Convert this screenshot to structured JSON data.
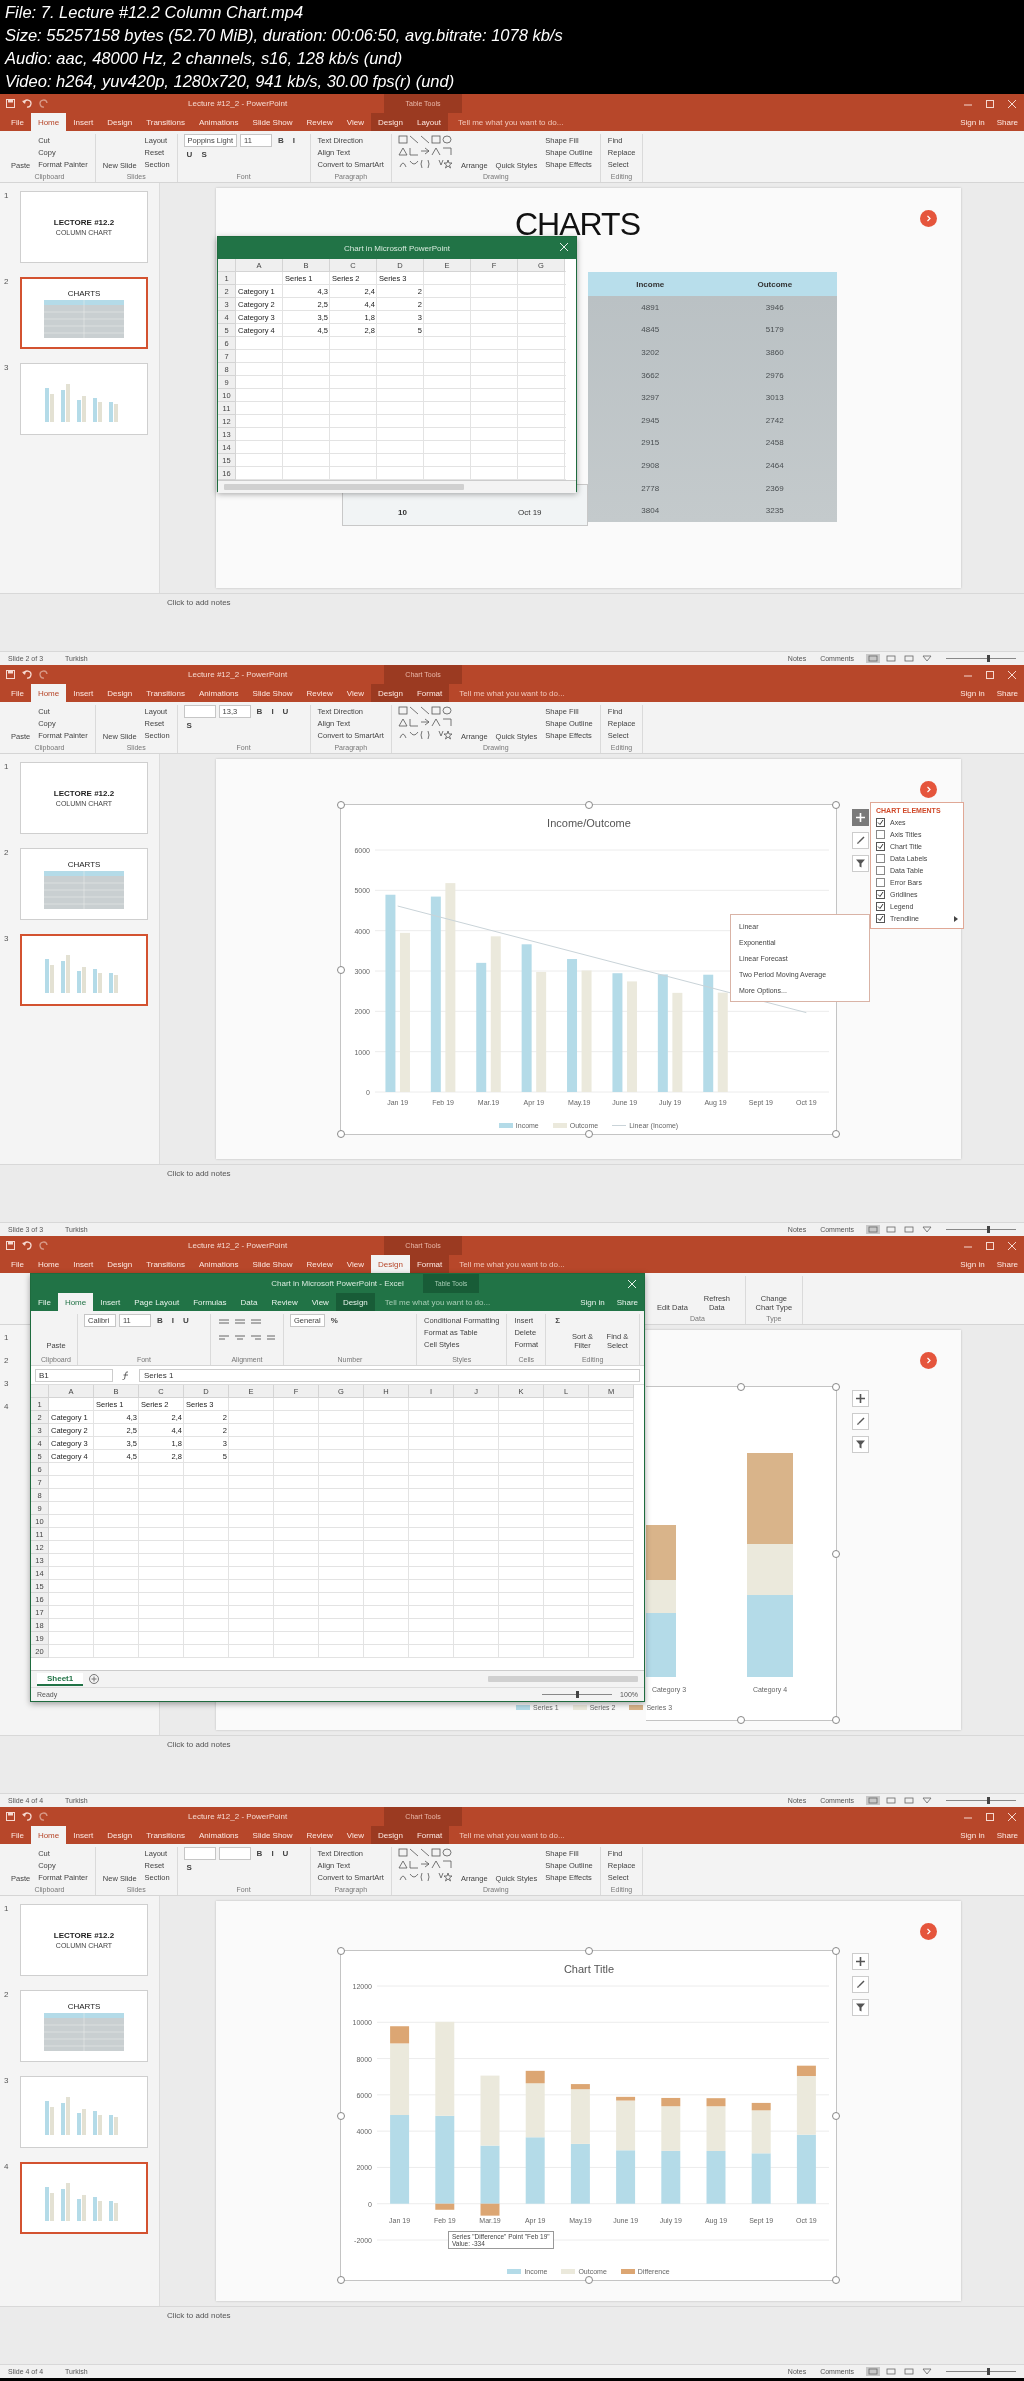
{
  "header": [
    "File: 7. Lecture #12.2 Column Chart.mp4",
    "Size: 55257158 bytes (52.70 MiB), duration: 00:06:50, avg.bitrate: 1078 kb/s",
    "Audio: aac, 48000 Hz, 2 channels, s16, 128 kb/s (und)",
    "Video: h264, yuv420p, 1280x720, 941 kb/s, 30.00 fps(r) (und)"
  ],
  "frames": [
    {
      "kind": "table",
      "title": "Lecture #12_2 - PowerPoint",
      "context_label": "Table Tools",
      "tabs": [
        {
          "label": "File",
          "selected": false,
          "contextual": false
        },
        {
          "label": "Home",
          "selected": true,
          "contextual": false
        },
        {
          "label": "Insert",
          "selected": false,
          "contextual": false
        },
        {
          "label": "Design",
          "selected": false,
          "contextual": false
        },
        {
          "label": "Transitions",
          "selected": false,
          "contextual": false
        },
        {
          "label": "Animations",
          "selected": false,
          "contextual": false
        },
        {
          "label": "Slide Show",
          "selected": false,
          "contextual": false
        },
        {
          "label": "Review",
          "selected": false,
          "contextual": false
        },
        {
          "label": "View",
          "selected": false,
          "contextual": false
        },
        {
          "label": "Design",
          "selected": false,
          "contextual": true
        },
        {
          "label": "Layout",
          "selected": false,
          "contextual": true
        }
      ],
      "tell_me": "Tell me what you want to do...",
      "sign_in": "Sign in",
      "share": "Share",
      "ribbon": [
        {
          "label": "Clipboard",
          "kind": "stack",
          "items": [
            {
              "kind": "big",
              "text": "Paste"
            },
            {
              "kind": "button",
              "text": "Cut"
            },
            {
              "kind": "button",
              "text": "Copy"
            },
            {
              "kind": "button",
              "text": "Format Painter"
            }
          ]
        },
        {
          "label": "Slides",
          "kind": "stack",
          "items": [
            {
              "kind": "big",
              "text": "New Slide"
            },
            {
              "kind": "button",
              "text": "Layout"
            },
            {
              "kind": "button",
              "text": "Reset"
            },
            {
              "kind": "button",
              "text": "Section"
            }
          ]
        },
        {
          "label": "Font",
          "kind": "wrap",
          "items": [
            {
              "kind": "field",
              "text": "Poppins Light"
            },
            {
              "kind": "field",
              "text": "11"
            },
            {
              "kind": "format",
              "text": "B"
            },
            {
              "kind": "format",
              "text": "I"
            },
            {
              "kind": "format",
              "text": "U"
            },
            {
              "kind": "format",
              "text": "S"
            }
          ]
        },
        {
          "label": "Paragraph",
          "kind": "stack",
          "items": [
            {
              "kind": "button",
              "text": "Text Direction"
            },
            {
              "kind": "button",
              "text": "Align Text"
            },
            {
              "kind": "button",
              "text": "Convert to SmartArt"
            }
          ]
        },
        {
          "label": "Drawing",
          "kind": "stack",
          "items": [
            {
              "kind": "shapes"
            },
            {
              "kind": "big",
              "text": "Arrange"
            },
            {
              "kind": "big",
              "text": "Quick Styles"
            },
            {
              "kind": "button",
              "text": "Shape Fill"
            },
            {
              "kind": "button",
              "text": "Shape Outline"
            },
            {
              "kind": "button",
              "text": "Shape Effects"
            }
          ]
        },
        {
          "label": "Editing",
          "kind": "stack",
          "items": [
            {
              "kind": "button",
              "text": "Find"
            },
            {
              "kind": "button",
              "text": "Replace"
            },
            {
              "kind": "button",
              "text": "Select"
            }
          ]
        }
      ],
      "thumbnails": [
        {
          "number": "1",
          "kind": "title",
          "title": "LECTORE #12.2",
          "subtitle": "COLUMN CHART",
          "selected": false
        },
        {
          "number": "2",
          "kind": "table",
          "title": "CHARTS",
          "selected": true
        },
        {
          "number": "3",
          "kind": "chart",
          "selected": false
        }
      ],
      "slide": {
        "title": "CHARTS",
        "table": {
          "columns": [
            "Income",
            "Outcome"
          ],
          "rows": [
            [
              "4891",
              "3946"
            ],
            [
              "4845",
              "5179"
            ],
            [
              "3202",
              "3860"
            ],
            [
              "3662",
              "2976"
            ],
            [
              "3297",
              "3013"
            ],
            [
              "2945",
              "2742"
            ],
            [
              "2915",
              "2458"
            ],
            [
              "2908",
              "2464"
            ],
            [
              "2778",
              "2369"
            ],
            [
              "3804",
              "3235"
            ]
          ]
        },
        "strip": [
          "10",
          "Oct 19"
        ],
        "excel": {
          "kind": "mini",
          "title": "Chart in Microsoft PowerPoint",
          "columns": [
            "A",
            "B",
            "C",
            "D",
            "E",
            "F",
            "G"
          ],
          "row_numbers": [
            "1",
            "2",
            "3",
            "4",
            "5",
            "6",
            "7",
            "8",
            "9",
            "10",
            "11",
            "12",
            "13",
            "14",
            "15",
            "16"
          ],
          "sheet": {
            "headers": [
              "Series 1",
              "Series 2",
              "Series 3"
            ],
            "rows": [
              {
                "label": "Category 1",
                "values": [
                  "4,3",
                  "2,4",
                  "2"
                ]
              },
              {
                "label": "Category 2",
                "values": [
                  "2,5",
                  "4,4",
                  "2"
                ]
              },
              {
                "label": "Category 3",
                "values": [
                  "3,5",
                  "1,8",
                  "3"
                ]
              },
              {
                "label": "Category 4",
                "values": [
                  "4,5",
                  "2,8",
                  "5"
                ]
              }
            ]
          }
        }
      },
      "notes_placeholder": "Click to add notes",
      "status": {
        "slide": "Slide 2 of 3",
        "language": "Turkish",
        "notes": "Notes",
        "comments": "Comments",
        "zoom": {
          "level": 0.6
        }
      }
    },
    {
      "kind": "chart",
      "title": "Lecture #12_2 - PowerPoint",
      "context_label": "Chart Tools",
      "tabs": [
        {
          "label": "File",
          "selected": false,
          "contextual": false
        },
        {
          "label": "Home",
          "selected": true,
          "contextual": false
        },
        {
          "label": "Insert",
          "selected": false,
          "contextual": false
        },
        {
          "label": "Design",
          "selected": false,
          "contextual": false
        },
        {
          "label": "Transitions",
          "selected": false,
          "contextual": false
        },
        {
          "label": "Animations",
          "selected": false,
          "contextual": false
        },
        {
          "label": "Slide Show",
          "selected": false,
          "contextual": false
        },
        {
          "label": "Review",
          "selected": false,
          "contextual": false
        },
        {
          "label": "View",
          "selected": false,
          "contextual": false
        },
        {
          "label": "Design",
          "selected": false,
          "contextual": true
        },
        {
          "label": "Format",
          "selected": false,
          "contextual": true
        }
      ],
      "tell_me": "Tell me what you want to do...",
      "sign_in": "Sign in",
      "share": "Share",
      "ribbon": [
        {
          "label": "Clipboard",
          "kind": "stack",
          "items": [
            {
              "kind": "big",
              "text": "Paste"
            },
            {
              "kind": "button",
              "text": "Cut"
            },
            {
              "kind": "button",
              "text": "Copy"
            },
            {
              "kind": "button",
              "text": "Format Painter"
            }
          ]
        },
        {
          "label": "Slides",
          "kind": "stack",
          "items": [
            {
              "kind": "big",
              "text": "New Slide"
            },
            {
              "kind": "button",
              "text": "Layout"
            },
            {
              "kind": "button",
              "text": "Reset"
            },
            {
              "kind": "button",
              "text": "Section"
            }
          ]
        },
        {
          "label": "Font",
          "kind": "wrap",
          "items": [
            {
              "kind": "field"
            },
            {
              "kind": "field",
              "text": "13,3"
            },
            {
              "kind": "format",
              "text": "B"
            },
            {
              "kind": "format",
              "text": "I"
            },
            {
              "kind": "format",
              "text": "U"
            },
            {
              "kind": "format",
              "text": "S"
            }
          ]
        },
        {
          "label": "Paragraph",
          "kind": "stack",
          "items": [
            {
              "kind": "button",
              "text": "Text Direction"
            },
            {
              "kind": "button",
              "text": "Align Text"
            },
            {
              "kind": "button",
              "text": "Convert to SmartArt"
            }
          ]
        },
        {
          "label": "Drawing",
          "kind": "stack",
          "items": [
            {
              "kind": "shapes"
            },
            {
              "kind": "big",
              "text": "Arrange"
            },
            {
              "kind": "big",
              "text": "Quick Styles"
            },
            {
              "kind": "button",
              "text": "Shape Fill"
            },
            {
              "kind": "button",
              "text": "Shape Outline"
            },
            {
              "kind": "button",
              "text": "Shape Effects"
            }
          ]
        },
        {
          "label": "Editing",
          "kind": "stack",
          "items": [
            {
              "kind": "button",
              "text": "Find"
            },
            {
              "kind": "button",
              "text": "Replace"
            },
            {
              "kind": "button",
              "text": "Select"
            }
          ]
        }
      ],
      "thumbnails": [
        {
          "number": "1",
          "kind": "title",
          "title": "LECTORE #12.2",
          "subtitle": "COLUMN CHART",
          "selected": false
        },
        {
          "number": "2",
          "kind": "table",
          "title": "CHARTS",
          "selected": false
        },
        {
          "number": "3",
          "kind": "chart",
          "selected": true
        }
      ],
      "slide": {
        "chart_data": {
          "type": "bar",
          "title": "Income/Outcome",
          "categories": [
            "Jan 19",
            "Feb 19",
            "Mar.19",
            "Apr 19",
            "May.19",
            "June 19",
            "July 19",
            "Aug 19",
            "Sept 19",
            "Oct 19"
          ],
          "series": [
            {
              "name": "Income",
              "color": "#b4dbe8",
              "values": [
                4891,
                4845,
                3202,
                3662,
                3297,
                2945,
                2915,
                2908,
                null,
                null
              ]
            },
            {
              "name": "Outcome",
              "color": "#ebe9dc",
              "values": [
                3946,
                5179,
                3860,
                2976,
                3013,
                2742,
                2458,
                2464,
                null,
                null
              ]
            }
          ],
          "yticks": [
            0,
            1000,
            2000,
            3000,
            4000,
            5000,
            6000
          ],
          "ylim": [
            0,
            6000
          ],
          "grid": true,
          "stacked": false
        },
        "trendline": {
          "label": "Linear (Income)"
        },
        "chart_elements": {
          "title": "CHART ELEMENTS",
          "items": [
            {
              "label": "Axes",
              "checked": true,
              "submenu": false
            },
            {
              "label": "Axis Titles",
              "checked": false,
              "submenu": false
            },
            {
              "label": "Chart Title",
              "checked": true,
              "submenu": false
            },
            {
              "label": "Data Labels",
              "checked": false,
              "submenu": false
            },
            {
              "label": "Data Table",
              "checked": false,
              "submenu": false
            },
            {
              "label": "Error Bars",
              "checked": false,
              "submenu": false
            },
            {
              "label": "Gridlines",
              "checked": true,
              "submenu": false
            },
            {
              "label": "Legend",
              "checked": true,
              "submenu": false
            },
            {
              "label": "Trendline",
              "checked": true,
              "submenu": true
            }
          ]
        },
        "submenu": [
          "Linear",
          "Exponential",
          "Linear Forecast",
          "Two Period Moving Average",
          "More Options..."
        ]
      },
      "notes_placeholder": "Click to add notes",
      "status": {
        "slide": "Slide 3 of 3",
        "language": "Turkish",
        "notes": "Notes",
        "comments": "Comments",
        "zoom": {
          "level": 0.6
        }
      }
    },
    {
      "kind": "excel_over_chart",
      "title": "Lecture #12_2 - PowerPoint",
      "context_label": "Chart Tools",
      "tabs": [
        {
          "label": "File",
          "selected": false,
          "contextual": false
        },
        {
          "label": "Home",
          "selected": false,
          "contextual": false
        },
        {
          "label": "Insert",
          "selected": false,
          "contextual": false
        },
        {
          "label": "Design",
          "selected": false,
          "contextual": false
        },
        {
          "label": "Transitions",
          "selected": false,
          "contextual": false
        },
        {
          "label": "Animations",
          "selected": false,
          "contextual": false
        },
        {
          "label": "Slide Show",
          "selected": false,
          "contextual": false
        },
        {
          "label": "Review",
          "selected": false,
          "contextual": false
        },
        {
          "label": "View",
          "selected": false,
          "contextual": false
        },
        {
          "label": "Design",
          "selected": true,
          "contextual": true
        },
        {
          "label": "Format",
          "selected": false,
          "contextual": true
        }
      ],
      "tell_me": "Tell me what you want to do...",
      "sign_in": "Sign in",
      "share": "Share",
      "ribbon": [
        {
          "label": "Data",
          "kind": "stack",
          "items": [
            {
              "kind": "big",
              "text": "Edit Data"
            },
            {
              "kind": "big",
              "text": "Refresh Data"
            }
          ]
        },
        {
          "label": "Type",
          "kind": "stack",
          "items": [
            {
              "kind": "big",
              "text": "Change Chart Type"
            }
          ]
        }
      ],
      "thumbnails": [
        {
          "number": "1",
          "kind": "covered"
        },
        {
          "number": "2",
          "kind": "covered"
        },
        {
          "number": "3",
          "kind": "covered"
        },
        {
          "number": "4",
          "kind": "covered"
        }
      ],
      "slide": {
        "categories": [
          "Category 3",
          "Category 4"
        ],
        "legend": [
          {
            "label": "Series 1",
            "color": "#b4dbe8"
          },
          {
            "label": "Series 2",
            "color": "#ebe9dc"
          },
          {
            "label": "Series 3",
            "color": "#d9b48a"
          }
        ],
        "excel": {
          "kind": "full",
          "title": "Chart in Microsoft PowerPoint - Excel",
          "context_label": "Table Tools",
          "tabs": [
            {
              "label": "File",
              "selected": false,
              "contextual": false
            },
            {
              "label": "Home",
              "selected": true,
              "contextual": false
            },
            {
              "label": "Insert",
              "selected": false,
              "contextual": false
            },
            {
              "label": "Page Layout",
              "selected": false,
              "contextual": false
            },
            {
              "label": "Formulas",
              "selected": false,
              "contextual": false
            },
            {
              "label": "Data",
              "selected": false,
              "contextual": false
            },
            {
              "label": "Review",
              "selected": false,
              "contextual": false
            },
            {
              "label": "View",
              "selected": false,
              "contextual": false
            },
            {
              "label": "Design",
              "selected": false,
              "contextual": true
            }
          ],
          "tell_me": "Tell me what you want to do...",
          "sign_in": "Sign in",
          "share": "Share",
          "ribbon": [
            {
              "label": "Clipboard",
              "kind": "stack",
              "items": [
                {
                  "kind": "big",
                  "text": "Paste"
                }
              ]
            },
            {
              "label": "Font",
              "kind": "wrap",
              "items": [
                {
                  "kind": "field",
                  "text": "Calibri"
                },
                {
                  "kind": "field",
                  "text": "11"
                },
                {
                  "kind": "format",
                  "text": "B"
                },
                {
                  "kind": "format",
                  "text": "I"
                },
                {
                  "kind": "format",
                  "text": "U"
                }
              ]
            },
            {
              "label": "Alignment",
              "kind": "stack",
              "items": [
                {
                  "kind": "align"
                }
              ]
            },
            {
              "label": "Number",
              "kind": "wrap",
              "items": [
                {
                  "kind": "field",
                  "text": "General"
                },
                {
                  "kind": "format",
                  "text": "%"
                }
              ]
            },
            {
              "label": "Styles",
              "kind": "stack",
              "items": [
                {
                  "kind": "button",
                  "text": "Conditional Formatting"
                },
                {
                  "kind": "button",
                  "text": "Format as Table"
                },
                {
                  "kind": "button",
                  "text": "Cell Styles"
                }
              ]
            },
            {
              "label": "Cells",
              "kind": "stack",
              "items": [
                {
                  "kind": "button",
                  "text": "Insert"
                },
                {
                  "kind": "button",
                  "text": "Delete"
                },
                {
                  "kind": "button",
                  "text": "Format"
                }
              ]
            },
            {
              "label": "Editing",
              "kind": "stack",
              "items": [
                {
                  "kind": "format",
                  "text": "Σ"
                },
                {
                  "kind": "big",
                  "text": "Sort & Filter"
                },
                {
                  "kind": "big",
                  "text": "Find & Select"
                }
              ]
            }
          ],
          "name_box": "B1",
          "formula": "Series 1",
          "columns": [
            "A",
            "B",
            "C",
            "D",
            "E",
            "F",
            "G",
            "H",
            "I",
            "J",
            "K",
            "L",
            "M"
          ],
          "row_numbers": [
            "1",
            "2",
            "3",
            "4",
            "5",
            "6",
            "7",
            "8",
            "9",
            "10",
            "11",
            "12",
            "13",
            "14",
            "15",
            "16",
            "17",
            "18",
            "19",
            "20"
          ],
          "sheet": {
            "headers": [
              "Series 1",
              "Series 2",
              "Series 3"
            ],
            "rows": [
              {
                "label": "Category 1",
                "values": [
                  "4,3",
                  "2,4",
                  "2"
                ]
              },
              {
                "label": "Category 2",
                "values": [
                  "2,5",
                  "4,4",
                  "2"
                ]
              },
              {
                "label": "Category 3",
                "values": [
                  "3,5",
                  "1,8",
                  "3"
                ]
              },
              {
                "label": "Category 4",
                "values": [
                  "4,5",
                  "2,8",
                  "5"
                ]
              }
            ]
          },
          "sheet_tab": "Sheet1",
          "status": "Ready",
          "zoom": {
            "label": "100%",
            "level": 0.5
          }
        }
      },
      "notes_placeholder": "Click to add notes",
      "status": {
        "slide": "Slide 4 of 4",
        "language": "Turkish",
        "notes": "Notes",
        "comments": "Comments",
        "zoom": {
          "level": 0.6
        }
      }
    },
    {
      "kind": "stacked_chart",
      "title": "Lecture #12_2 - PowerPoint",
      "context_label": "Chart Tools",
      "tabs": [
        {
          "label": "File",
          "selected": false,
          "contextual": false
        },
        {
          "label": "Home",
          "selected": true,
          "contextual": false
        },
        {
          "label": "Insert",
          "selected": false,
          "contextual": false
        },
        {
          "label": "Design",
          "selected": false,
          "contextual": false
        },
        {
          "label": "Transitions",
          "selected": false,
          "contextual": false
        },
        {
          "label": "Animations",
          "selected": false,
          "contextual": false
        },
        {
          "label": "Slide Show",
          "selected": false,
          "contextual": false
        },
        {
          "label": "Review",
          "selected": false,
          "contextual": false
        },
        {
          "label": "View",
          "selected": false,
          "contextual": false
        },
        {
          "label": "Design",
          "selected": false,
          "contextual": true
        },
        {
          "label": "Format",
          "selected": false,
          "contextual": true
        }
      ],
      "tell_me": "Tell me what you want to do...",
      "sign_in": "Sign in",
      "share": "Share",
      "ribbon": [
        {
          "label": "Clipboard",
          "kind": "stack",
          "items": [
            {
              "kind": "big",
              "text": "Paste"
            },
            {
              "kind": "button",
              "text": "Cut"
            },
            {
              "kind": "button",
              "text": "Copy"
            },
            {
              "kind": "button",
              "text": "Format Painter"
            }
          ]
        },
        {
          "label": "Slides",
          "kind": "stack",
          "items": [
            {
              "kind": "big",
              "text": "New Slide"
            },
            {
              "kind": "button",
              "text": "Layout"
            },
            {
              "kind": "button",
              "text": "Reset"
            },
            {
              "kind": "button",
              "text": "Section"
            }
          ]
        },
        {
          "label": "Font",
          "kind": "wrap",
          "items": [
            {
              "kind": "field"
            },
            {
              "kind": "field"
            },
            {
              "kind": "format",
              "text": "B"
            },
            {
              "kind": "format",
              "text": "I"
            },
            {
              "kind": "format",
              "text": "U"
            },
            {
              "kind": "format",
              "text": "S"
            }
          ]
        },
        {
          "label": "Paragraph",
          "kind": "stack",
          "items": [
            {
              "kind": "button",
              "text": "Text Direction"
            },
            {
              "kind": "button",
              "text": "Align Text"
            },
            {
              "kind": "button",
              "text": "Convert to SmartArt"
            }
          ]
        },
        {
          "label": "Drawing",
          "kind": "stack",
          "items": [
            {
              "kind": "shapes"
            },
            {
              "kind": "big",
              "text": "Arrange"
            },
            {
              "kind": "big",
              "text": "Quick Styles"
            },
            {
              "kind": "button",
              "text": "Shape Fill"
            },
            {
              "kind": "button",
              "text": "Shape Outline"
            },
            {
              "kind": "button",
              "text": "Shape Effects"
            }
          ]
        },
        {
          "label": "Editing",
          "kind": "stack",
          "items": [
            {
              "kind": "button",
              "text": "Find"
            },
            {
              "kind": "button",
              "text": "Replace"
            },
            {
              "kind": "button",
              "text": "Select"
            }
          ]
        }
      ],
      "thumbnails": [
        {
          "number": "1",
          "kind": "title",
          "title": "LECTORE #12.2",
          "subtitle": "COLUMN CHART",
          "selected": false
        },
        {
          "number": "2",
          "kind": "table",
          "title": "CHARTS",
          "selected": false
        },
        {
          "number": "3",
          "kind": "chart",
          "selected": false
        },
        {
          "number": "4",
          "kind": "chart",
          "selected": true
        }
      ],
      "slide": {
        "chart_data": {
          "type": "bar",
          "title": "Chart Title",
          "categories": [
            "Jan 19",
            "Feb 19",
            "Mar.19",
            "Apr 19",
            "May.19",
            "June 19",
            "July 19",
            "Aug 19",
            "Sept 19",
            "Oct 19"
          ],
          "series": [
            {
              "name": "Income",
              "color": "#b4dbe8",
              "values": [
                4891,
                4845,
                3202,
                3662,
                3297,
                2945,
                2915,
                2908,
                2778,
                3804
              ]
            },
            {
              "name": "Outcome",
              "color": "#ebe9dc",
              "values": [
                3946,
                5179,
                3860,
                2976,
                3013,
                2742,
                2458,
                2464,
                2369,
                3235
              ]
            },
            {
              "name": "Difference",
              "color": "#dca673",
              "values": [
                945,
                -334,
                -658,
                686,
                284,
                203,
                457,
                444,
                409,
                569
              ]
            }
          ],
          "yticks": [
            -2000,
            0,
            2000,
            4000,
            6000,
            8000,
            10000,
            12000
          ],
          "ylim": [
            -2000,
            12000
          ],
          "grid": true,
          "stacked": true
        },
        "tooltip": [
          "Series \"Difference\" Point \"Feb 19\"",
          "Value: -334"
        ]
      },
      "notes_placeholder": "Click to add notes",
      "status": {
        "slide": "Slide 4 of 4",
        "language": "Turkish",
        "notes": "Notes",
        "comments": "Comments",
        "zoom": {
          "level": 0.6
        }
      }
    }
  ]
}
